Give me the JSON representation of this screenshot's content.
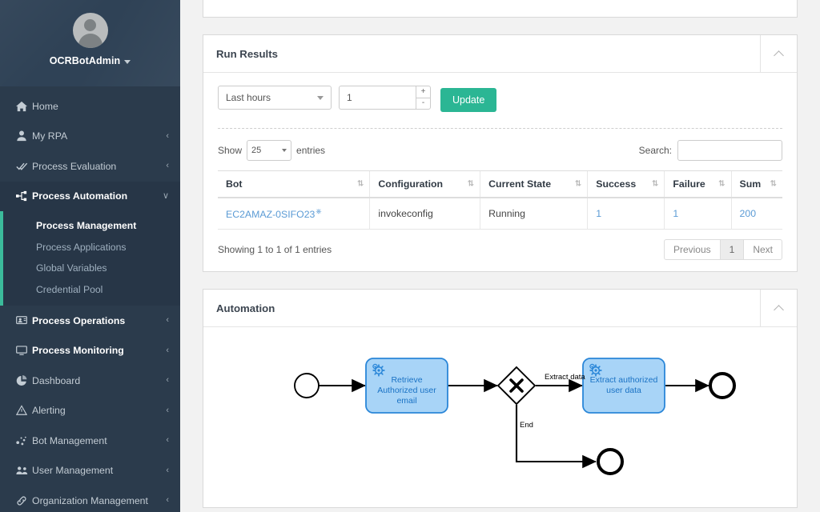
{
  "sidebar": {
    "username": "OCRBotAdmin",
    "avatar_icon": "user-avatar-icon",
    "caret_icon": "caret-down-icon",
    "items": [
      {
        "label": "Home",
        "icon": "home-icon",
        "chevron": "",
        "bold": false
      },
      {
        "label": "My RPA",
        "icon": "person-icon",
        "chevron": "‹",
        "bold": false
      },
      {
        "label": "Process Evaluation",
        "icon": "double-check-icon",
        "chevron": "‹",
        "bold": false
      },
      {
        "label": "Process Automation",
        "icon": "sitemap-icon",
        "chevron": "∨",
        "bold": true
      }
    ],
    "sub_items": [
      {
        "label": "Process Management",
        "selected": true
      },
      {
        "label": "Process Applications",
        "selected": false
      },
      {
        "label": "Global Variables",
        "selected": false
      },
      {
        "label": "Credential Pool",
        "selected": false
      }
    ],
    "items_after": [
      {
        "label": "Process Operations",
        "icon": "monitor-person-icon",
        "chevron": "‹",
        "bold": true
      },
      {
        "label": "Process Monitoring",
        "icon": "desktop-icon",
        "chevron": "‹",
        "bold": true
      },
      {
        "label": "Dashboard",
        "icon": "pie-chart-icon",
        "chevron": "‹",
        "bold": false
      },
      {
        "label": "Alerting",
        "icon": "warning-triangle-icon",
        "chevron": "‹",
        "bold": false
      },
      {
        "label": "Bot Management",
        "icon": "bot-nodes-icon",
        "chevron": "‹",
        "bold": false
      },
      {
        "label": "User Management",
        "icon": "users-group-icon",
        "chevron": "‹",
        "bold": false
      },
      {
        "label": "Organization Management",
        "icon": "link-chain-icon",
        "chevron": "‹",
        "bold": false
      }
    ],
    "accent_color": "#3bbb9b",
    "background_color": "#2b3b4c"
  },
  "run_results": {
    "title": "Run Results",
    "collapse_icon": "chevron-up-icon",
    "range_select": {
      "value": "Last hours",
      "caret_icon": "caret-down-icon"
    },
    "amount_input": {
      "value": "1",
      "placeholder": ""
    },
    "spinner_up": "+",
    "spinner_down": "-",
    "update_button": "Update",
    "update_button_color": "#2bb694",
    "show_label": "Show",
    "entries_label": "entries",
    "page_length": "25",
    "search_label": "Search:",
    "search_value": "",
    "search_placeholder": "",
    "columns": [
      "Bot",
      "Configuration",
      "Current State",
      "Success",
      "Failure",
      "Sum"
    ],
    "sort_glyph": "⇅",
    "rows": [
      {
        "bot": "EC2AMAZ-0SIFO23",
        "bot_external_icon": "external-link-icon",
        "configuration": "invokeconfig",
        "current_state": "Running",
        "success": "1",
        "failure": "1",
        "sum": "200"
      }
    ],
    "info": "Showing 1 to 1 of 1 entries",
    "pagination": {
      "previous": "Previous",
      "pages": [
        "1"
      ],
      "next": "Next"
    }
  },
  "automation": {
    "title": "Automation",
    "collapse_icon": "chevron-up-icon",
    "diagram": {
      "start_event": {
        "name": "start-event"
      },
      "tasks": [
        {
          "id": "task-retrieve",
          "label": "Retrieve Authorized user email",
          "icon": "service-task-gear-icon"
        },
        {
          "id": "task-extract",
          "label": "Extract authorized user data",
          "icon": "service-task-gear-icon"
        }
      ],
      "gateway": {
        "name": "exclusive-gateway",
        "glyph": "✕"
      },
      "flow_labels": [
        "Extract data",
        "End"
      ],
      "end_events": [
        {
          "name": "end-event-top"
        },
        {
          "name": "end-event-bottom"
        }
      ],
      "task_fill": "#a8d4f7",
      "task_stroke": "#2a86d8",
      "task_text_color": "#1a72c4"
    }
  }
}
